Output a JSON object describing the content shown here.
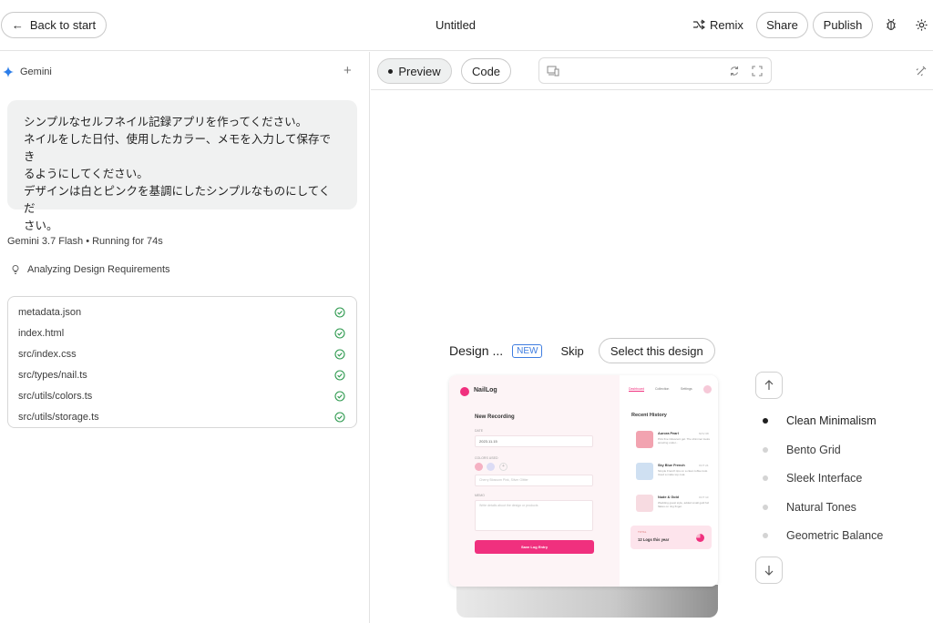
{
  "header": {
    "back_label": "Back to start",
    "title": "Untitled",
    "remix_label": "Remix",
    "share_label": "Share",
    "publish_label": "Publish"
  },
  "sidebar": {
    "model_name": "Gemini",
    "prompt_lines": [
      "シンプルなセルフネイル記録アプリを作ってください。",
      "ネイルをした日付、使用したカラー、メモを入力して保存でき",
      "るようにしてください。",
      "デザインは白とピンクを基調にしたシンプルなものにしてくだ",
      "さい。"
    ],
    "status": "Gemini 3.7 Flash • Running for 74s",
    "analyzing": "Analyzing Design Requirements",
    "files": [
      "metadata.json",
      "index.html",
      "src/index.css",
      "src/types/nail.ts",
      "src/utils/colors.ts",
      "src/utils/storage.ts"
    ]
  },
  "preview": {
    "tab_preview": "Preview",
    "tab_code": "Code",
    "design_label": "Design ...",
    "new_badge": "NEW",
    "skip_label": "Skip",
    "select_label": "Select this design",
    "options": [
      "Clean Minimalism",
      "Bento Grid",
      "Sleek Interface",
      "Natural Tones",
      "Geometric Balance"
    ],
    "selected_option": "Clean Minimalism"
  },
  "mini_app": {
    "brand": "NailLog",
    "nav": [
      "Dashboard",
      "Collection",
      "Settings"
    ],
    "form_title": "New Recording",
    "date_label": "DATE",
    "date_value": "2023.11.15",
    "colors_label": "COLORS USED",
    "colors_placeholder": "Cherry Blossom Pink, Silver Glitter",
    "memo_label": "MEMO",
    "memo_placeholder": "Write details about the design or products",
    "save_label": "Save Log Entry",
    "history_title": "Recent History",
    "history": [
      {
        "name": "Aurora Pearl",
        "date": "NOV 08",
        "desc": "Pink fine iridescent gel. The shimmer looks amazing under..."
      },
      {
        "name": "Sky Blue French",
        "date": "OCT 24",
        "desc": "Simple French tips on a clear coffee look. Used a matte top coat."
      },
      {
        "name": "Nude & Gold",
        "date": "OCT 10",
        "desc": "Wedding guest style, added small gold foil flakes on ring finger."
      }
    ],
    "count_label": "TOTAL",
    "count_value": "12 Logs this year"
  },
  "colors": {
    "accent_pink": "#f0307e",
    "light_pink": "#f2a3b0",
    "light_blue": "#cfe0f2",
    "border": "#c9c9c9"
  }
}
